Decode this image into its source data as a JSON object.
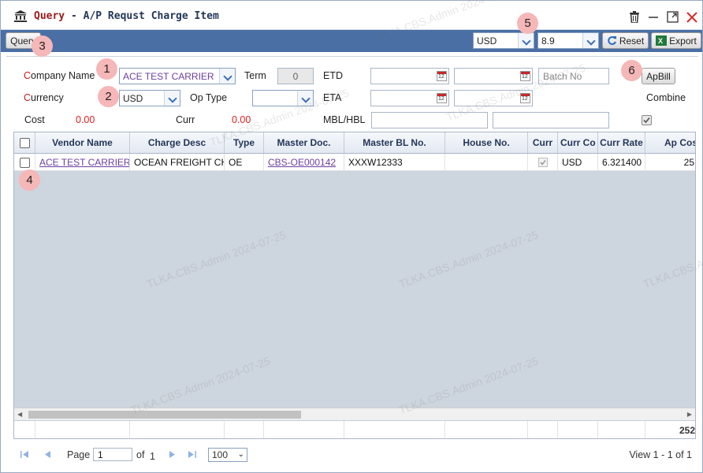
{
  "window": {
    "title_prefix": "Query",
    "title_suffix": " - A/P Requst Charge Item"
  },
  "toolbar": {
    "query_label": "Query",
    "currency_value": "USD",
    "rate_value": "8.9",
    "reset_label": "Reset",
    "export_label": "Export"
  },
  "form": {
    "company_label_first": "C",
    "company_label_rest": "ompany Name",
    "company_value": "ACE TEST CARRIER",
    "term_label": "Term",
    "term_value": "0",
    "etd_label": "ETD",
    "batch_placeholder": "Batch No",
    "apbill_label": "ApBill",
    "currency_label_first": "C",
    "currency_label_rest": "urrency",
    "currency_value": "USD",
    "optype_label": "Op Type",
    "optype_value": "",
    "eta_label": "ETA",
    "combine_label": "Combine",
    "cost_label": "Cost",
    "cost_value": "0.00",
    "curr_label": "Curr",
    "curr_value": "0.00",
    "mblhbl_label": "MBL/HBL"
  },
  "grid": {
    "columns": [
      "Vendor Name",
      "Charge Desc",
      "Type",
      "Master Doc.",
      "Master BL No.",
      "House No.",
      "Curr",
      "Curr Co",
      "Curr Rate",
      "Ap Cos"
    ],
    "rows": [
      {
        "vendor": "ACE TEST CARRIER",
        "charge_desc": "OCEAN FREIGHT CH",
        "type": "OE",
        "master_doc": "CBS-OE000142",
        "master_bl": "XXXW12333",
        "house_no": "",
        "curr_co": "USD",
        "curr_rate": "6.321400",
        "ap_cost": "25"
      }
    ],
    "footer_total": "252"
  },
  "pager": {
    "page_label": "Page",
    "page_value": "1",
    "of_label": "of",
    "total_pages": "1",
    "page_size": "100",
    "view_text": "View 1 - 1 of 1"
  },
  "badges": [
    "1",
    "2",
    "3",
    "4",
    "5",
    "6"
  ],
  "watermark": "TLKA.CBS.Admin 2024-07-25",
  "colors": {
    "toolbar_bg": "#4a6fa5",
    "title_accent": "#9b1c1c",
    "value_red": "#e02020",
    "link_purple": "#6b3fa0"
  }
}
